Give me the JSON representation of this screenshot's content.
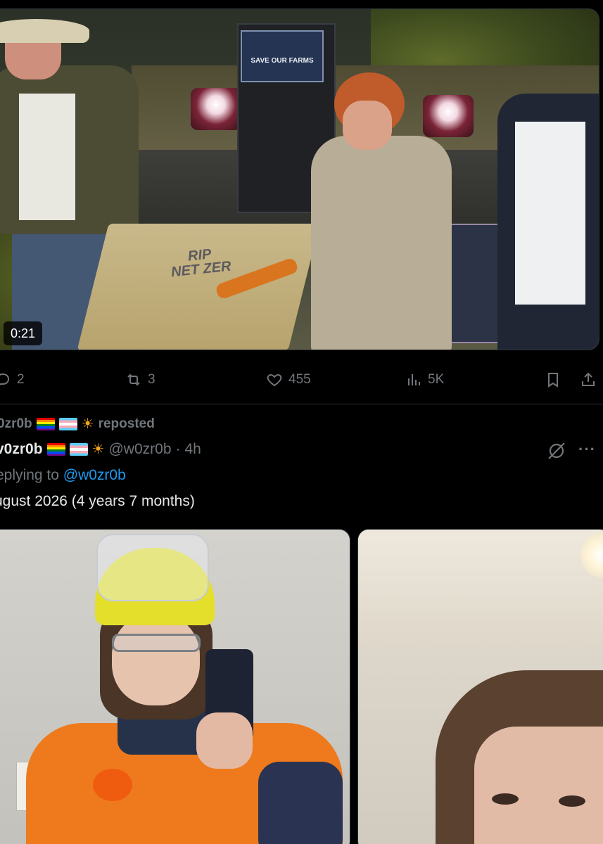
{
  "video": {
    "duration": "0:21",
    "podium_sign": "SAVE OUR FARMS",
    "coffin_text": "RIP\nNET ZER"
  },
  "actions": {
    "replies": "2",
    "reposts": "3",
    "likes": "455",
    "views": "5K"
  },
  "repost_header": {
    "name": "0zr0b",
    "suffix": "reposted"
  },
  "tweet": {
    "author_name": "v0zr0b",
    "handle": "@w0zr0b",
    "separator": "·",
    "time": "4h",
    "replying_prefix": "eplying to",
    "replying_handle": "@w0zr0b",
    "text": "ugust 2026 (4 years 7 months)"
  },
  "colors": {
    "background": "#000000",
    "text": "#e7e9ea",
    "muted": "#71767b",
    "link": "#1d9bf0",
    "divider": "#2f3336"
  }
}
